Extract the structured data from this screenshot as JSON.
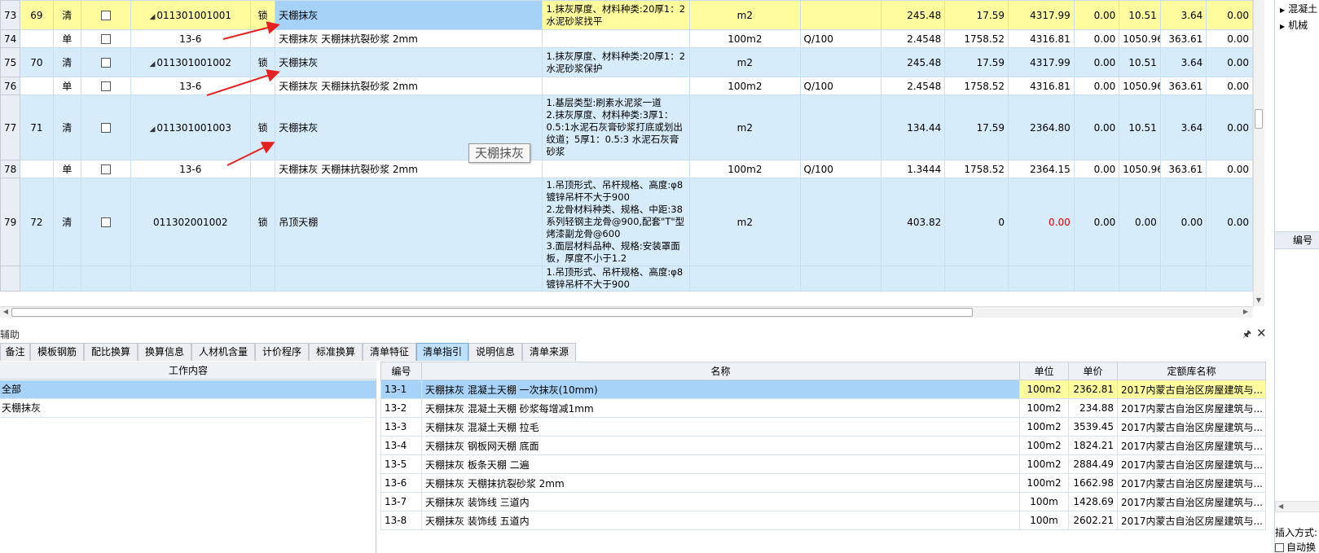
{
  "colors": {
    "qing_row": "#d7ecfb",
    "highlight_row": "#fffc9e",
    "selected_cell": "#a6d2f7",
    "arrow_red": "#e52222",
    "negative_red": "#e00000"
  },
  "main_grid": {
    "rows": [
      {
        "rownum": "73",
        "seq": "69",
        "type": "清",
        "code": "011301001001",
        "expand": "◢",
        "lock": "锁",
        "name": "天棚抹灰",
        "features": "1.抹灰厚度、材料种类:20厚1：2水泥砂浆找平",
        "unit": "m2",
        "qty_expr": "",
        "qty": "245.48",
        "price": "17.59",
        "total": "4317.99",
        "c1": "0.00",
        "c2": "10.51",
        "c3": "3.64",
        "c4": "0.00",
        "style": "hl"
      },
      {
        "rownum": "74",
        "seq": "",
        "type": "单",
        "code": "13-6",
        "expand": "",
        "lock": "",
        "name": "天棚抹灰 天棚抹抗裂砂浆 2mm",
        "features": "",
        "unit": "100m2",
        "qty_expr": "Q/100",
        "qty": "2.4548",
        "price": "1758.52",
        "total": "4316.81",
        "c1": "0.00",
        "c2": "1050.96",
        "c3": "363.61",
        "c4": "0.00",
        "style": "dan"
      },
      {
        "rownum": "75",
        "seq": "70",
        "type": "清",
        "code": "011301001002",
        "expand": "◢",
        "lock": "锁",
        "name": "天棚抹灰",
        "features": "1.抹灰厚度、材料种类:20厚1：2水泥砂浆保护",
        "unit": "m2",
        "qty_expr": "",
        "qty": "245.48",
        "price": "17.59",
        "total": "4317.99",
        "c1": "0.00",
        "c2": "10.51",
        "c3": "3.64",
        "c4": "0.00",
        "style": "qing"
      },
      {
        "rownum": "76",
        "seq": "",
        "type": "单",
        "code": "13-6",
        "expand": "",
        "lock": "",
        "name": "天棚抹灰 天棚抹抗裂砂浆 2mm",
        "features": "",
        "unit": "100m2",
        "qty_expr": "Q/100",
        "qty": "2.4548",
        "price": "1758.52",
        "total": "4316.81",
        "c1": "0.00",
        "c2": "1050.96",
        "c3": "363.61",
        "c4": "0.00",
        "style": "dan"
      },
      {
        "rownum": "77",
        "seq": "71",
        "type": "清",
        "code": "011301001003",
        "expand": "◢",
        "lock": "锁",
        "name": "天棚抹灰",
        "features": "1.基层类型:刷素水泥浆一道\n2.抹灰厚度、材料种类:3厚1：0.5:1水泥石灰膏砂浆打底或划出纹道；5厚1：0.5:3 水泥石灰膏砂浆",
        "unit": "m2",
        "qty_expr": "",
        "qty": "134.44",
        "price": "17.59",
        "total": "2364.80",
        "c1": "0.00",
        "c2": "10.51",
        "c3": "3.64",
        "c4": "0.00",
        "style": "qing"
      },
      {
        "rownum": "78",
        "seq": "",
        "type": "单",
        "code": "13-6",
        "expand": "",
        "lock": "",
        "name": "天棚抹灰 天棚抹抗裂砂浆 2mm",
        "features": "",
        "unit": "100m2",
        "qty_expr": "Q/100",
        "qty": "1.3444",
        "price": "1758.52",
        "total": "2364.15",
        "c1": "0.00",
        "c2": "1050.96",
        "c3": "363.61",
        "c4": "0.00",
        "style": "dan"
      },
      {
        "rownum": "79",
        "seq": "72",
        "type": "清",
        "code": "011302001002",
        "expand": "",
        "lock": "锁",
        "name": "吊顶天棚",
        "features": "1.吊顶形式、吊杆规格、高度:φ8镀锌吊杆不大于900\n2.龙骨材料种类、规格、中距:38系列轻钢主龙骨@900,配套\"T\"型烤漆副龙骨@600\n3.面层材料品种、规格:安装罩面板，厚度不小于1.2",
        "unit": "m2",
        "qty_expr": "",
        "qty": "403.82",
        "price": "0",
        "total": "0.00",
        "c1": "0.00",
        "c2": "0.00",
        "c3": "0.00",
        "c4": "0.00",
        "style": "qing"
      },
      {
        "rownum": "",
        "seq": "",
        "type": "",
        "code": "",
        "expand": "",
        "lock": "",
        "name": "",
        "features": "1.吊顶形式、吊杆规格、高度:φ8镀锌吊杆不大于900",
        "unit": "",
        "qty_expr": "",
        "qty": "",
        "price": "",
        "total": "",
        "c1": "",
        "c2": "",
        "c3": "",
        "c4": "",
        "style": "qing"
      }
    ]
  },
  "tooltip": "天棚抹灰",
  "right_panel": {
    "tree_items": [
      "混凝土",
      "机械"
    ],
    "col_header": "编号",
    "insert_mode": "插入方式:",
    "auto_replace": "自动换"
  },
  "aux": {
    "title": "辅助",
    "pin": "🖈",
    "close": "✕",
    "tabs": [
      "备注",
      "模板钢筋",
      "配比换算",
      "换算信息",
      "人材机含量",
      "计价程序",
      "标准换算",
      "清单特征",
      "清单指引",
      "说明信息",
      "清单来源"
    ],
    "active_tab": 8
  },
  "work_content": {
    "header": "工作内容",
    "items": [
      "全部",
      "天棚抹灰"
    ]
  },
  "reference": {
    "headers": {
      "code": "编号",
      "name": "名称",
      "unit": "单位",
      "price": "单价",
      "lib": "定额库名称"
    },
    "rows": [
      {
        "code": "13-1",
        "name": "天棚抹灰 混凝土天棚 一次抹灰(10mm)",
        "unit": "100m2",
        "price": "2362.81",
        "lib": "2017内蒙古自治区房屋建筑与..."
      },
      {
        "code": "13-2",
        "name": "天棚抹灰 混凝土天棚 砂浆每增减1mm",
        "unit": "100m2",
        "price": "234.88",
        "lib": "2017内蒙古自治区房屋建筑与..."
      },
      {
        "code": "13-3",
        "name": "天棚抹灰 混凝土天棚 拉毛",
        "unit": "100m2",
        "price": "3539.45",
        "lib": "2017内蒙古自治区房屋建筑与..."
      },
      {
        "code": "13-4",
        "name": "天棚抹灰 钢板网天棚 底面",
        "unit": "100m2",
        "price": "1824.21",
        "lib": "2017内蒙古自治区房屋建筑与..."
      },
      {
        "code": "13-5",
        "name": "天棚抹灰 板条天棚 二遍",
        "unit": "100m2",
        "price": "2884.49",
        "lib": "2017内蒙古自治区房屋建筑与..."
      },
      {
        "code": "13-6",
        "name": "天棚抹灰 天棚抹抗裂砂浆 2mm",
        "unit": "100m2",
        "price": "1662.98",
        "lib": "2017内蒙古自治区房屋建筑与..."
      },
      {
        "code": "13-7",
        "name": "天棚抹灰 装饰线 三道内",
        "unit": "100m",
        "price": "1428.69",
        "lib": "2017内蒙古自治区房屋建筑与..."
      },
      {
        "code": "13-8",
        "name": "天棚抹灰 装饰线 五道内",
        "unit": "100m",
        "price": "2602.21",
        "lib": "2017内蒙古自治区房屋建筑与..."
      }
    ]
  }
}
